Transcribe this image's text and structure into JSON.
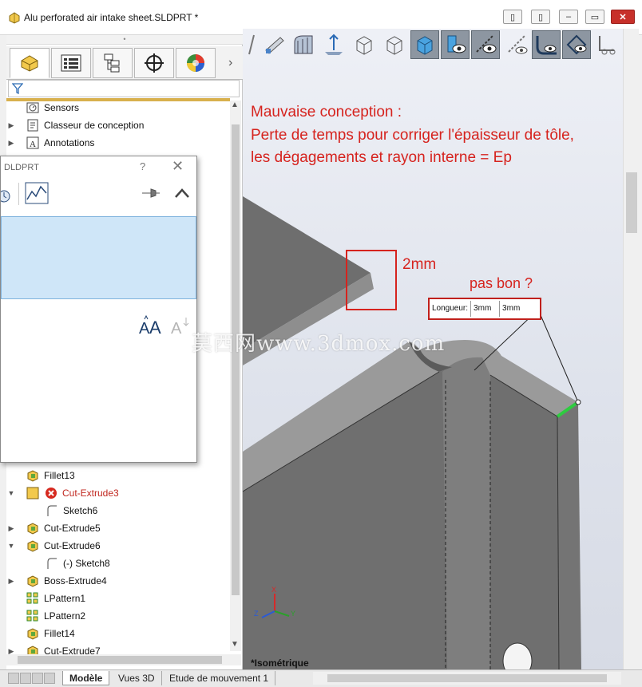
{
  "window": {
    "title": "Alu perforated air intake sheet.SLDPRT *",
    "buttons": [
      "restore-left",
      "restore-right",
      "minimize",
      "maximize",
      "close"
    ]
  },
  "panel": {
    "tabs": [
      "FeatureManager",
      "PropertyManager",
      "ConfigurationManager",
      "DimXpertManager",
      "DisplayManager"
    ],
    "filter_placeholder": "",
    "tree_top": [
      {
        "label": "Sensors",
        "icon": "sensor-icon"
      },
      {
        "label": "Classeur de conception",
        "icon": "design-binder-icon"
      },
      {
        "label": "Annotations",
        "icon": "annotations-icon"
      }
    ],
    "tree_bottom": [
      {
        "label": "Fillet13",
        "icon": "feature-icon",
        "expand": ""
      },
      {
        "label": "Cut-Extrude3",
        "icon": "feature-icon",
        "expand": "▼",
        "error": true
      },
      {
        "label": "Sketch6",
        "icon": "sketch-icon",
        "expand": ""
      },
      {
        "label": "Cut-Extrude5",
        "icon": "feature-icon",
        "expand": "▶"
      },
      {
        "label": "Cut-Extrude6",
        "icon": "feature-icon",
        "expand": "▼"
      },
      {
        "label": "(-) Sketch8",
        "icon": "sketch-icon",
        "expand": ""
      },
      {
        "label": "Boss-Extrude4",
        "icon": "feature-icon",
        "expand": "▶"
      },
      {
        "label": "LPattern1",
        "icon": "pattern-icon",
        "expand": ""
      },
      {
        "label": "LPattern2",
        "icon": "pattern-icon",
        "expand": ""
      },
      {
        "label": "Fillet14",
        "icon": "feature-icon",
        "expand": ""
      },
      {
        "label": "Cut-Extrude7",
        "icon": "feature-icon",
        "expand": "▶"
      }
    ]
  },
  "dialog": {
    "title": "DLDPRT",
    "help": "?",
    "close": "✕"
  },
  "annotations": {
    "heading_line1": "Mauvaise conception :",
    "heading_line2": "Perte de temps pour corriger l'épaisseur de tôle,",
    "heading_line3": "les dégagements et rayon interne = Ep",
    "thickness": "2mm",
    "question": "pas bon ?"
  },
  "dimension": {
    "label": "Longueur:",
    "value1": "3mm",
    "value2": "3mm"
  },
  "view_name": "*Isométrique",
  "watermark": "莫西网www.3dmox.com",
  "bottom_tabs": [
    "Modèle",
    "Vues 3D",
    "Etude de mouvement 1"
  ],
  "colors": {
    "annotation_red": "#d6231e",
    "sheet_gray": "#6e6e6e",
    "edge_green": "#2ecc40",
    "selection_blue": "#cfe6f8"
  }
}
